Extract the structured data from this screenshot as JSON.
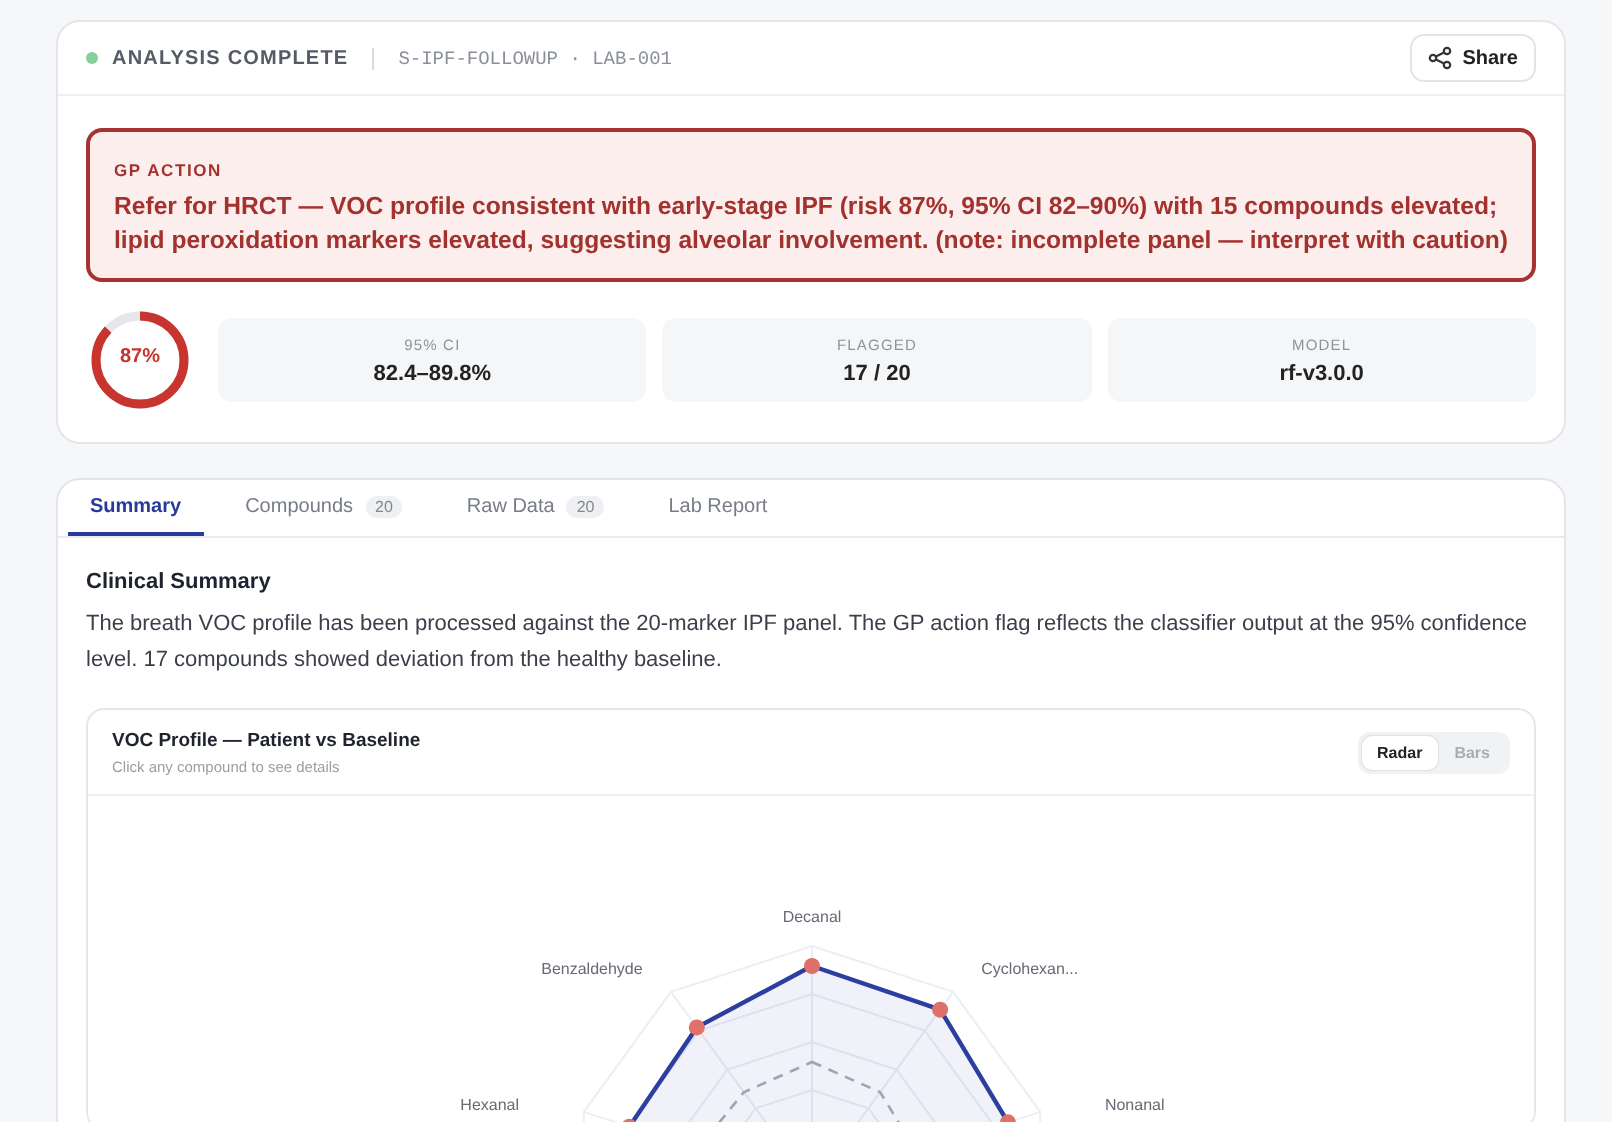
{
  "header": {
    "status": {
      "label": "ANALYSIS COMPLETE",
      "color": "#86d19a"
    },
    "sample_id": "S-IPF-FOLLOWUP · LAB-001",
    "share_button": "Share"
  },
  "alert": {
    "title": "GP ACTION",
    "message": "Refer for HRCT — VOC profile consistent with early-stage IPF (risk 87%, 95% CI 82–90%) with 15 compounds elevated; lipid peroxidation markers elevated, suggesting alveolar involvement. (note: incomplete panel — interpret with caution)"
  },
  "risk": {
    "label": "87%",
    "level": 0.87
  },
  "stats": [
    {
      "label": "95% CI",
      "value": "82.4–89.8%"
    },
    {
      "label": "FLAGGED",
      "value": "17 / 20"
    },
    {
      "label": "MODEL",
      "value": "rf-v3.0.0"
    }
  ],
  "tabs": [
    {
      "label": "Summary",
      "selected": true
    },
    {
      "label": "Compounds",
      "count": "20",
      "selected": false
    },
    {
      "label": "Raw Data",
      "count": "20",
      "selected": false
    },
    {
      "label": "Lab Report",
      "selected": false
    }
  ],
  "summary": {
    "title": "Clinical Summary",
    "text": "The breath VOC profile has been processed against the 20-marker IPF panel. The GP action flag reflects the classifier output at the 95% confidence level. 17 compounds showed deviation from the healthy baseline."
  },
  "chart_card": {
    "title": "VOC Profile — Patient vs Baseline",
    "subtitle": "Click any compound to see details",
    "view_toggle": [
      {
        "label": "Radar",
        "selected": true
      },
      {
        "label": "Bars",
        "selected": false
      }
    ],
    "axis_labels": [
      "Decanal",
      "Cyclohexan...",
      "Nonanal",
      "Hexanal",
      "Benzaldehyde"
    ]
  }
}
